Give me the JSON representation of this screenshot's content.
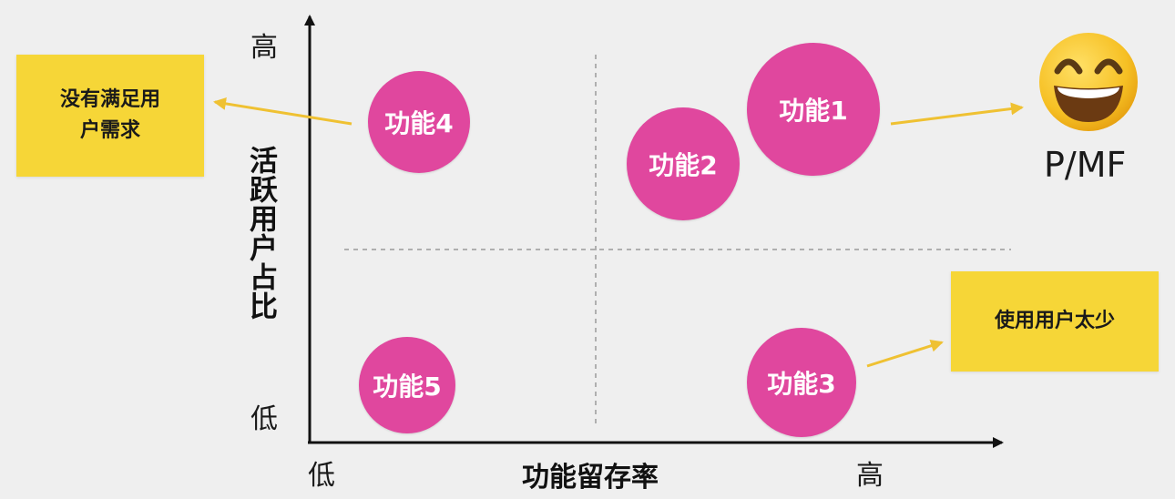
{
  "axes": {
    "x_title": "功能留存率",
    "y_title": "活跃用户占比",
    "x_low": "低",
    "x_high": "高",
    "y_low": "低",
    "y_high": "高"
  },
  "features": [
    {
      "label": "功能1"
    },
    {
      "label": "功能2"
    },
    {
      "label": "功能3"
    },
    {
      "label": "功能4"
    },
    {
      "label": "功能5"
    }
  ],
  "notes": {
    "unmet_needs": "没有满足用户需求",
    "few_users": "使用用户太少"
  },
  "pmf": {
    "label": "P/MF",
    "icon": "grinning-face-icon"
  },
  "colors": {
    "bubble": "#e0479e",
    "note": "#f6d637",
    "arrow": "#efc132",
    "axis": "#111111",
    "divider": "#9a9a9a"
  }
}
